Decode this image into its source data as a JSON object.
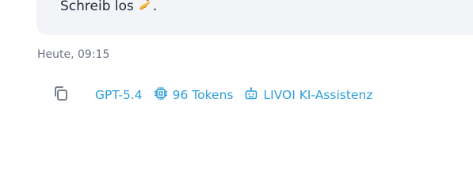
{
  "message": {
    "text": "Schreib los",
    "emoji": "✍️",
    "punctuation": "."
  },
  "timestamp": "Heute, 09:15",
  "meta": {
    "model": "GPT-5.4",
    "tokens": "96 Tokens",
    "assistant": "LIVOI KI-Assistenz"
  },
  "icons": {
    "copy": "copy-icon",
    "chip": "chip-icon",
    "bot": "bot-icon"
  },
  "colors": {
    "accent": "#2f9fd8",
    "bubble_bg": "#f2f4f7",
    "muted": "#6b7280"
  }
}
